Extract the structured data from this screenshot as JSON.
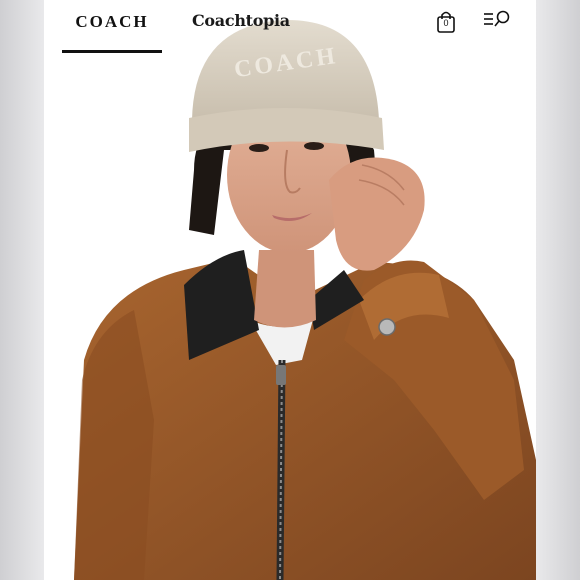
{
  "header": {
    "brand": "COACH",
    "sub_brand": "Coachtopia",
    "bag_count": "0",
    "icons": {
      "bag": "shopping-bag-icon",
      "menu": "menu-icon",
      "search": "search-icon"
    }
  },
  "hero": {
    "beanie_text": "COACH",
    "description": "Model wearing a cream beanie and brown zip jacket with a dark corduroy collar"
  },
  "colors": {
    "jacket": "#9a5a2b",
    "beanie": "#d8cfbf",
    "collar": "#1c1c1c",
    "background": "#ffffff"
  }
}
